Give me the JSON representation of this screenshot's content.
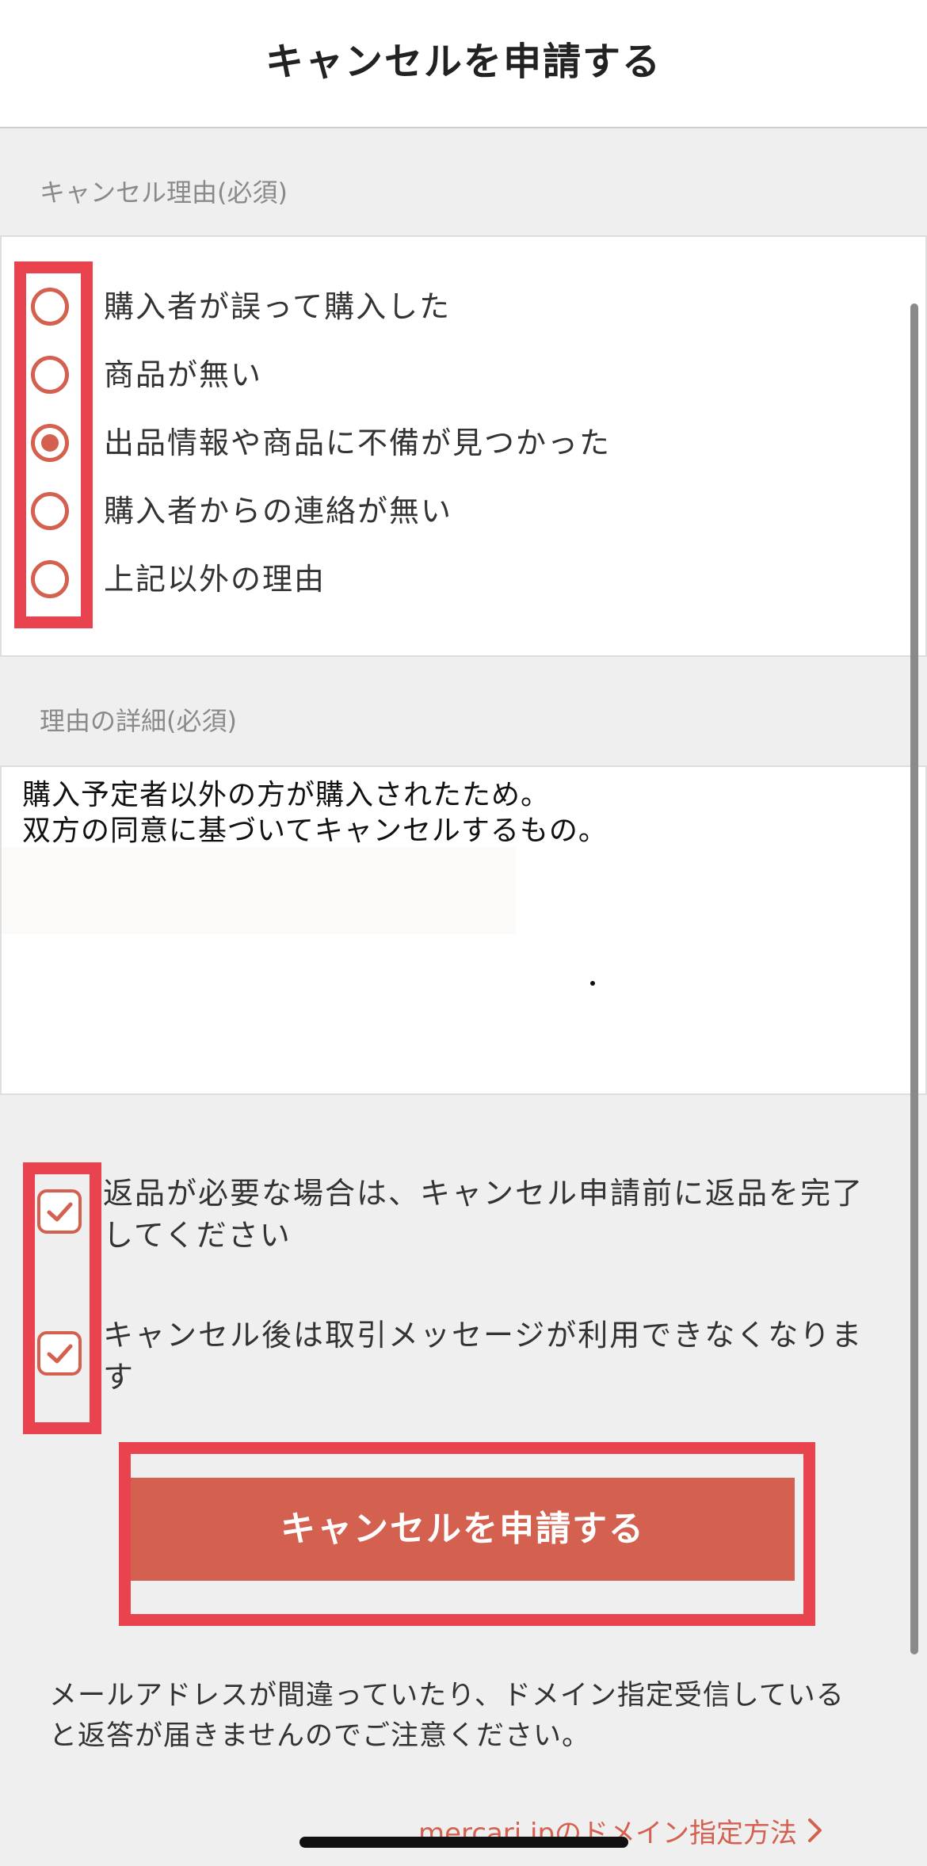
{
  "colors": {
    "accent": "#d4604f",
    "highlight": "#e8434f",
    "background": "#efefef"
  },
  "header": {
    "title": "キャンセルを申請する"
  },
  "reason_section": {
    "label": "キャンセル理由(必須)",
    "options": [
      {
        "label": "購入者が誤って購入した",
        "selected": false
      },
      {
        "label": "商品が無い",
        "selected": false
      },
      {
        "label": "出品情報や商品に不備が見つかった",
        "selected": true
      },
      {
        "label": "購入者からの連絡が無い",
        "selected": false
      },
      {
        "label": "上記以外の理由",
        "selected": false
      }
    ]
  },
  "detail_section": {
    "label": "理由の詳細(必須)",
    "value": "購入予定者以外の方が購入されたため。\n双方の同意に基づいてキャンセルするもの。"
  },
  "confirmations": [
    {
      "text": "返品が必要な場合は、キャンセル申請前に返品を完了\nしてください",
      "checked": true
    },
    {
      "text": "キャンセル後は取引メッセージが利用できなくなりま\nす",
      "checked": true
    }
  ],
  "submit_button": {
    "label": "キャンセルを申請する"
  },
  "notice": {
    "text": "メールアドレスが間違っていたり、ドメイン指定受信している\nと返答が届きませんのでご注意ください。"
  },
  "domain_link": {
    "label": "mercari.jpのドメイン指定方法",
    "icon": "chevron-right-icon"
  }
}
